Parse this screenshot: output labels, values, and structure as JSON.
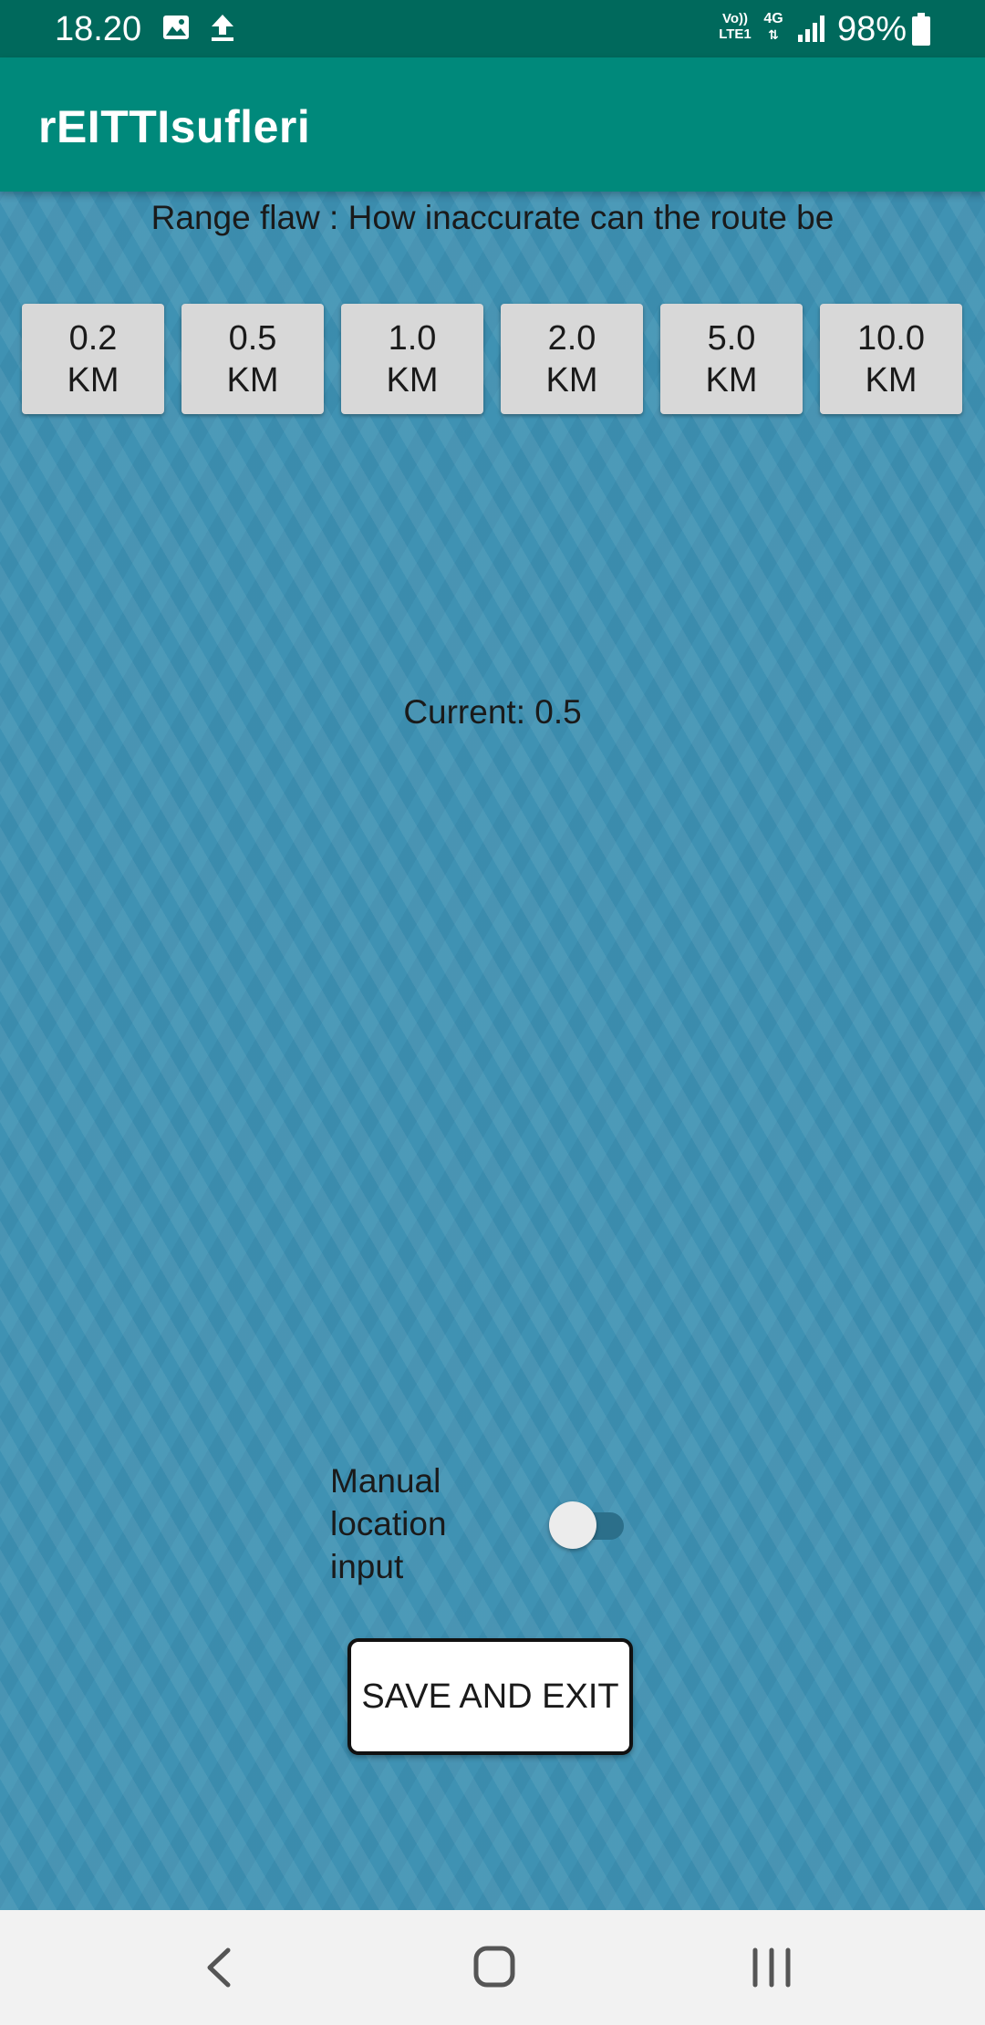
{
  "status_bar": {
    "time": "18.20",
    "volte_top": "Vo))",
    "volte_bottom": "LTE1",
    "network": "4G",
    "battery": "98%",
    "icons": [
      "gallery-icon",
      "upload-icon",
      "signal-icon",
      "battery-icon"
    ]
  },
  "app_bar": {
    "title": "rEITTIsufleri"
  },
  "range": {
    "label": "Range flaw : How inaccurate can the route be",
    "options": [
      "0.2\nKM",
      "0.5\nKM",
      "1.0\nKM",
      "2.0\nKM",
      "5.0\nKM",
      "10.0\nKM"
    ],
    "current": "Current: 0.5"
  },
  "manual_location": {
    "label": "Manual\nlocation\ninput",
    "enabled": false
  },
  "save_button": {
    "label": "SAVE AND EXIT"
  },
  "nav": {
    "icons": [
      "back-icon",
      "home-icon",
      "recent-apps-icon"
    ]
  },
  "colors": {
    "status_bar": "#00695c",
    "app_bar": "#00897b",
    "background": "#3f92b3",
    "button": "#d8d8d8",
    "toggle_track": "#2c6f8a"
  }
}
